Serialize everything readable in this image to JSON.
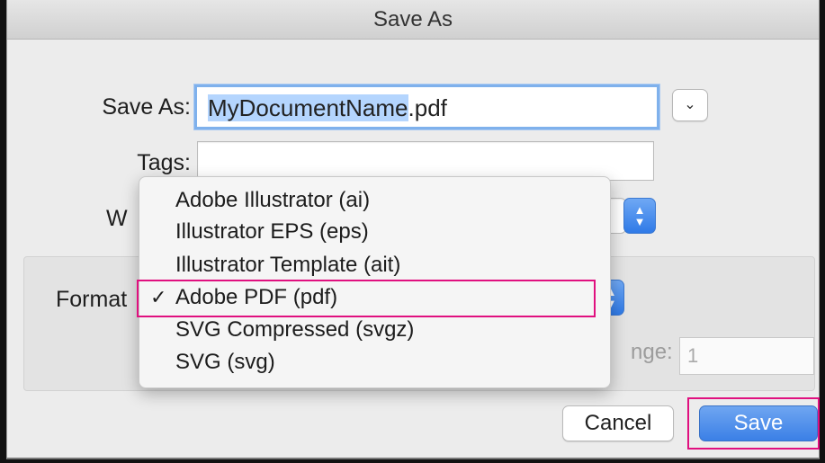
{
  "window": {
    "title": "Save As"
  },
  "form": {
    "save_as_label": "Save As:",
    "filename_selected": "MyDocumentName",
    "filename_ext": ".pdf",
    "tags_label": "Tags:",
    "tags_value": "",
    "where_label_partial": "W",
    "format_label": "Format",
    "range_label_partial": "nge:",
    "range_value": "1"
  },
  "format_menu": {
    "items": [
      {
        "label": "Adobe Illustrator (ai)",
        "checked": false
      },
      {
        "label": "Illustrator EPS (eps)",
        "checked": false
      },
      {
        "label": "Illustrator Template (ait)",
        "checked": false
      },
      {
        "label": "Adobe PDF (pdf)",
        "checked": true
      },
      {
        "label": "SVG Compressed (svgz)",
        "checked": false
      },
      {
        "label": "SVG (svg)",
        "checked": false
      }
    ],
    "check_glyph": "✓"
  },
  "buttons": {
    "cancel": "Cancel",
    "save": "Save"
  },
  "icons": {
    "expand": "chevron-down-icon",
    "stepper": "up-down-stepper-icon"
  },
  "colors": {
    "highlight": "#e0107f",
    "accent": "#3b80e6",
    "selection": "#b4d5fe"
  }
}
